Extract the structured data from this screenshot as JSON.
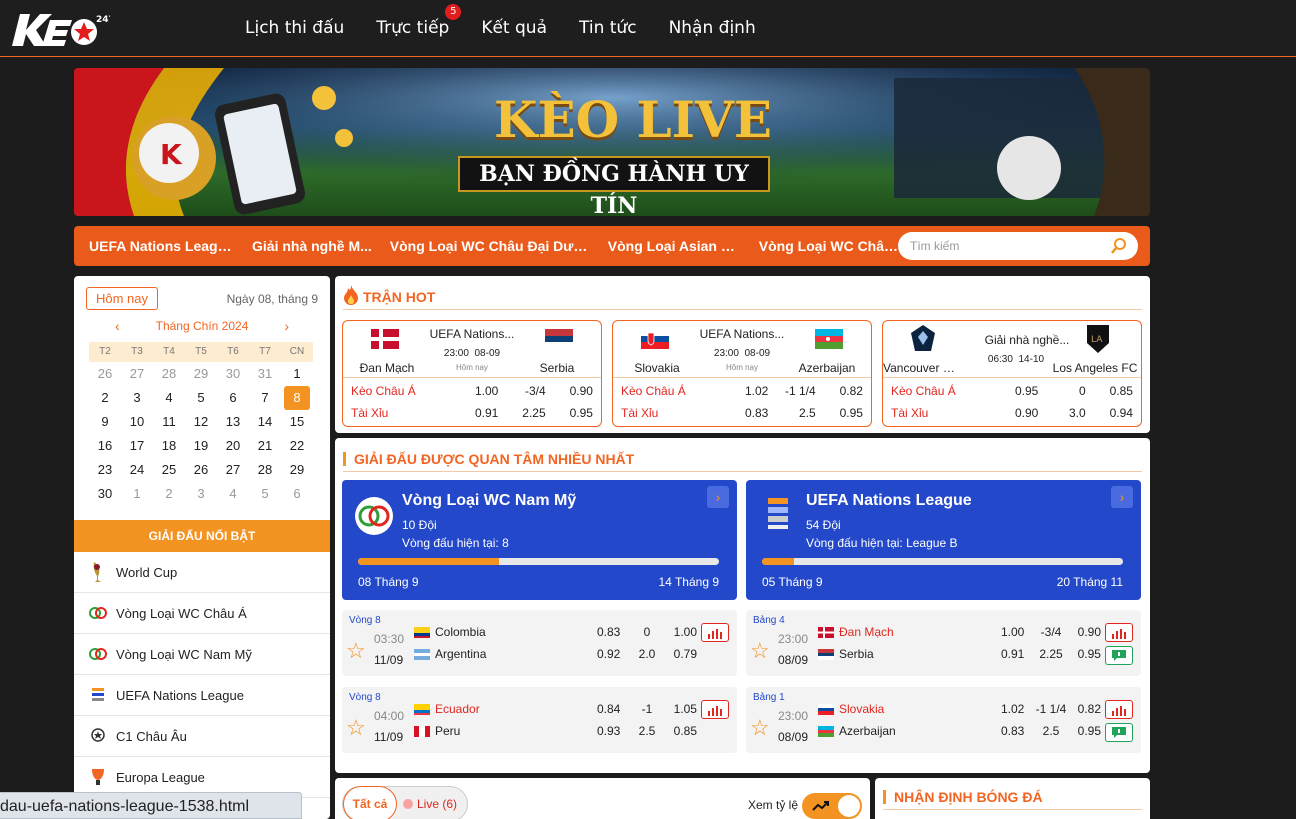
{
  "header": {
    "logo_text": "KEO",
    "logo_sub": "247",
    "nav": [
      {
        "label": "Lịch thi đấu"
      },
      {
        "label": "Trực tiếp",
        "badge": "5"
      },
      {
        "label": "Kết quả"
      },
      {
        "label": "Tin tức"
      },
      {
        "label": "Nhận định"
      }
    ]
  },
  "banner": {
    "title": "KÈO LIVE",
    "subtitle": "BẠN ĐỒNG HÀNH UY TÍN"
  },
  "ticker": {
    "links": [
      "UEFA Nations Leagu...",
      "Giải nhà nghề M...",
      "Vòng Loại WC Châu Đại Dươn...",
      "Vòng Loại Asian Cu...",
      "Vòng Loại WC Châu ..."
    ],
    "search_placeholder": "Tìm kiếm"
  },
  "calendar": {
    "today_label": "Hôm nay",
    "date_label": "Ngày 08, tháng 9",
    "month_label": "Tháng Chín 2024",
    "weekdays": [
      "T2",
      "T3",
      "T4",
      "T5",
      "T6",
      "T7",
      "CN"
    ],
    "days": [
      {
        "d": "26",
        "o": true
      },
      {
        "d": "27",
        "o": true
      },
      {
        "d": "28",
        "o": true
      },
      {
        "d": "29",
        "o": true
      },
      {
        "d": "30",
        "o": true
      },
      {
        "d": "31",
        "o": true
      },
      {
        "d": "1"
      },
      {
        "d": "2"
      },
      {
        "d": "3"
      },
      {
        "d": "4"
      },
      {
        "d": "5"
      },
      {
        "d": "6"
      },
      {
        "d": "7"
      },
      {
        "d": "8",
        "sel": true
      },
      {
        "d": "9"
      },
      {
        "d": "10"
      },
      {
        "d": "11"
      },
      {
        "d": "12"
      },
      {
        "d": "13"
      },
      {
        "d": "14"
      },
      {
        "d": "15"
      },
      {
        "d": "16"
      },
      {
        "d": "17"
      },
      {
        "d": "18"
      },
      {
        "d": "19"
      },
      {
        "d": "20"
      },
      {
        "d": "21"
      },
      {
        "d": "22"
      },
      {
        "d": "23"
      },
      {
        "d": "24"
      },
      {
        "d": "25"
      },
      {
        "d": "26"
      },
      {
        "d": "27"
      },
      {
        "d": "28"
      },
      {
        "d": "29"
      },
      {
        "d": "30"
      },
      {
        "d": "1",
        "o": true
      },
      {
        "d": "2",
        "o": true
      },
      {
        "d": "3",
        "o": true
      },
      {
        "d": "4",
        "o": true
      },
      {
        "d": "5",
        "o": true
      },
      {
        "d": "6",
        "o": true
      }
    ]
  },
  "featured": {
    "title": "GIẢI ĐẤU NỔI BẬT",
    "leagues": [
      "World Cup",
      "Vòng Loại WC Châu Á",
      "Vòng Loại WC Nam Mỹ",
      "UEFA Nations League",
      "C1 Châu Âu",
      "Europa League"
    ]
  },
  "hot": {
    "title": "TRẬN HOT",
    "handicap_label": "Kèo Châu Á",
    "ou_label": "Tài Xỉu",
    "sub_label": "Hôm nay",
    "matches": [
      {
        "league": "UEFA Nations...",
        "time": "23:00",
        "date": "08-09",
        "home": "Đan Mạch",
        "away": "Serbia",
        "sub": "Hôm nay",
        "ah": [
          "1.00",
          "-3/4",
          "0.90"
        ],
        "ou": [
          "0.91",
          "2.25",
          "0.95"
        ]
      },
      {
        "league": "UEFA Nations...",
        "time": "23:00",
        "date": "08-09",
        "home": "Slovakia",
        "away": "Azerbaijan",
        "sub": "Hôm nay",
        "ah": [
          "1.02",
          "-1 1/4",
          "0.82"
        ],
        "ou": [
          "0.83",
          "2.5",
          "0.95"
        ]
      },
      {
        "league": "Giải nhà nghề...",
        "time": "06:30",
        "date": "14-10",
        "home": "Vancouver W...",
        "away": "Los Angeles FC",
        "sub": "",
        "ah": [
          "0.95",
          "0",
          "0.85"
        ],
        "ou": [
          "0.90",
          "3.0",
          "0.94"
        ]
      }
    ]
  },
  "tournaments": {
    "title": "GIẢI ĐẤU ĐƯỢC QUAN TÂM NHIỀU NHẤT",
    "cards": [
      {
        "name": "Vòng Loại WC Nam Mỹ",
        "count": "10 Đội",
        "round": "Vòng đấu hiện tại: 8",
        "start": "08 Tháng 9",
        "end": "14 Tháng 9",
        "progress": 0.39
      },
      {
        "name": "UEFA Nations League",
        "count": "54 Đội",
        "round": "Vòng đấu hiện tại: League B",
        "start": "05 Tháng 9",
        "end": "20 Tháng 11",
        "progress": 0.09
      }
    ],
    "matches": [
      {
        "round": "Vòng 8",
        "time": "03:30",
        "date": "11/09",
        "home": "Colombia",
        "away": "Argentina",
        "o1": [
          "0.83",
          "0",
          "1.00"
        ],
        "o2": [
          "0.92",
          "2.0",
          "0.79"
        ],
        "red": false,
        "chat": false
      },
      {
        "round": "Bảng 4",
        "time": "23:00",
        "date": "08/09",
        "home": "Đan Mạch",
        "away": "Serbia",
        "o1": [
          "1.00",
          "-3/4",
          "0.90"
        ],
        "o2": [
          "0.91",
          "2.25",
          "0.95"
        ],
        "red": true,
        "chat": true
      },
      {
        "round": "Vòng 8",
        "time": "04:00",
        "date": "11/09",
        "home": "Ecuador",
        "away": "Peru",
        "o1": [
          "0.84",
          "-1",
          "1.05"
        ],
        "o2": [
          "0.93",
          "2.5",
          "0.85"
        ],
        "red": true,
        "chat": false
      },
      {
        "round": "Bảng 1",
        "time": "23:00",
        "date": "08/09",
        "home": "Slovakia",
        "away": "Azerbaijan",
        "o1": [
          "1.02",
          "-1 1/4",
          "0.82"
        ],
        "o2": [
          "0.83",
          "2.5",
          "0.95"
        ],
        "red": true,
        "chat": true
      }
    ]
  },
  "filter": {
    "all_label": "Tất cả",
    "live_label": "Live (6)",
    "odds_label": "Xem tỷ lệ"
  },
  "predict": {
    "title": "NHẬN ĐỊNH BÓNG ĐÁ"
  },
  "status_url": "dau-uefa-nations-league-1538.html",
  "colors": {
    "accent": "#f26522",
    "brand_blue": "#2348c9",
    "gold": "#f39322"
  }
}
